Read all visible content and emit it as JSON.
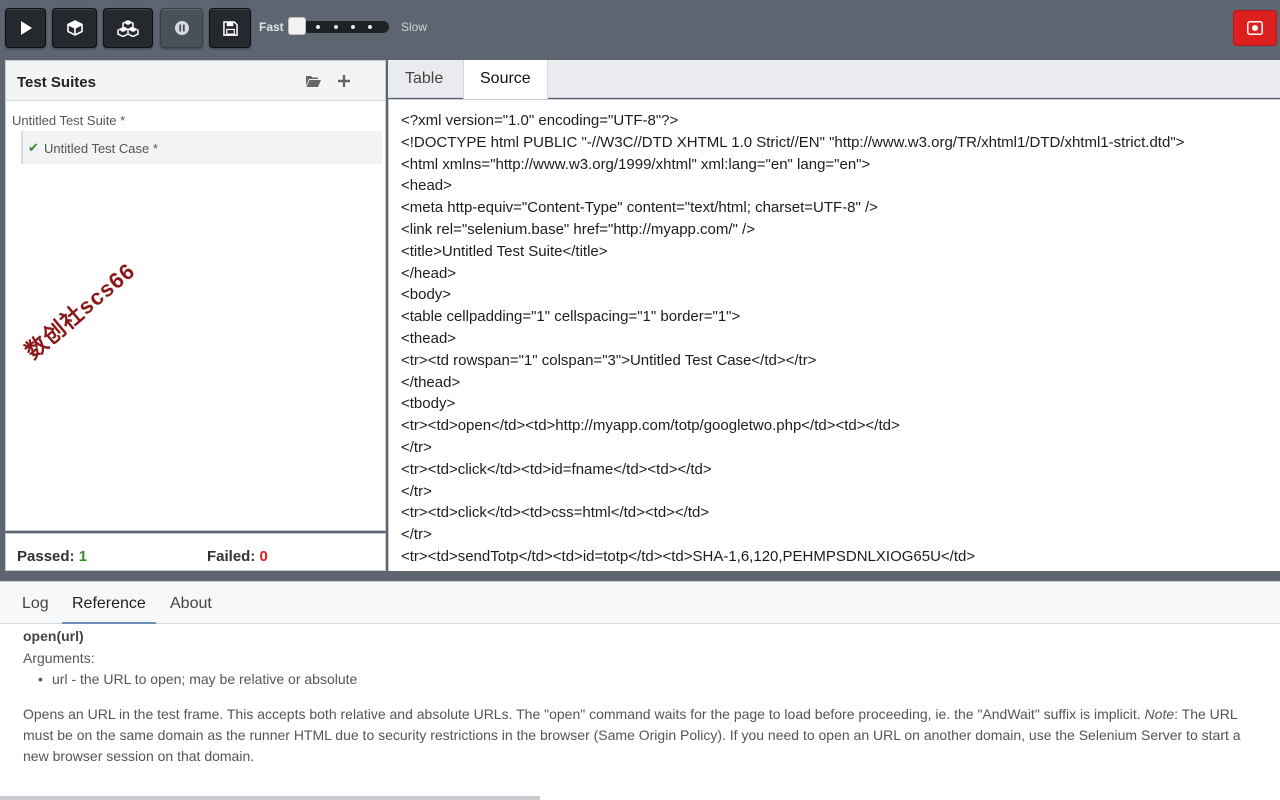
{
  "toolbar": {
    "buttons": [
      {
        "name": "run-test-button",
        "icon": "play-icon"
      },
      {
        "name": "run-suite-button",
        "icon": "cube-icon"
      },
      {
        "name": "run-all-button",
        "icon": "cubes-icon"
      },
      {
        "name": "pause-button",
        "icon": "pause-icon"
      },
      {
        "name": "save-button",
        "icon": "floppy-icon"
      }
    ],
    "speed_fast": "Fast",
    "speed_slow": "Slow",
    "speed_value": 0,
    "record_icon": "record-icon",
    "record_color": "#dc1f1f"
  },
  "suites": {
    "title": "Test Suites",
    "open_icon": "folder-open-icon",
    "add_icon": "plus-icon",
    "suite_name": "Untitled Test Suite *",
    "case_check": "✔",
    "case_name": "Untitled Test Case *"
  },
  "watermark": "数创社scs66",
  "status": {
    "passed_label": "Passed:",
    "passed_value": "1",
    "failed_label": "Failed:",
    "failed_value": "0",
    "pass_color": "#3b8a2e",
    "fail_color": "#d81e1e"
  },
  "editor": {
    "tabs": [
      "Table",
      "Source"
    ],
    "active_tab": "Source",
    "source_lines": [
      "<?xml version=\"1.0\" encoding=\"UTF-8\"?>",
      "<!DOCTYPE html PUBLIC \"-//W3C//DTD XHTML 1.0 Strict//EN\" \"http://www.w3.org/TR/xhtml1/DTD/xhtml1-strict.dtd\">",
      "<html xmlns=\"http://www.w3.org/1999/xhtml\" xml:lang=\"en\" lang=\"en\">",
      "<head>",
      "<meta http-equiv=\"Content-Type\" content=\"text/html; charset=UTF-8\" />",
      "<link rel=\"selenium.base\" href=\"http://myapp.com/\" />",
      "<title>Untitled Test Suite</title>",
      "</head>",
      "<body>",
      "<table cellpadding=\"1\" cellspacing=\"1\" border=\"1\">",
      "<thead>",
      "<tr><td rowspan=\"1\" colspan=\"3\">Untitled Test Case</td></tr>",
      "</thead>",
      "<tbody>",
      "<tr><td>open</td><td>http://myapp.com/totp/googletwo.php</td><td></td>",
      "</tr>",
      "<tr><td>click</td><td>id=fname</td><td></td>",
      "</tr>",
      "<tr><td>click</td><td>css=html</td><td></td>",
      "</tr>",
      "<tr><td>sendTotp</td><td>id=totp</td><td>SHA-1,6,120,PEHMPSDNLXIOG65U</td>"
    ]
  },
  "bottom": {
    "tabs": [
      "Log",
      "Reference",
      "About"
    ],
    "active_tab": "Reference",
    "ref_title": "open(url)",
    "ref_args_label": "Arguments:",
    "ref_arg": "url - the URL to open; may be relative or absolute",
    "ref_desc_1": "Opens an URL in the test frame. This accepts both relative and absolute URLs. The \"open\" command waits for the page to load before proceeding, ie. the \"AndWait\" suffix is implicit. ",
    "ref_desc_note": "Note",
    "ref_desc_2": ": The URL must be on the same domain as the runner HTML due to security restrictions in the browser (Same Origin Policy). If you need to open an URL on another domain, use the Selenium Server to start a new browser session on that domain."
  }
}
